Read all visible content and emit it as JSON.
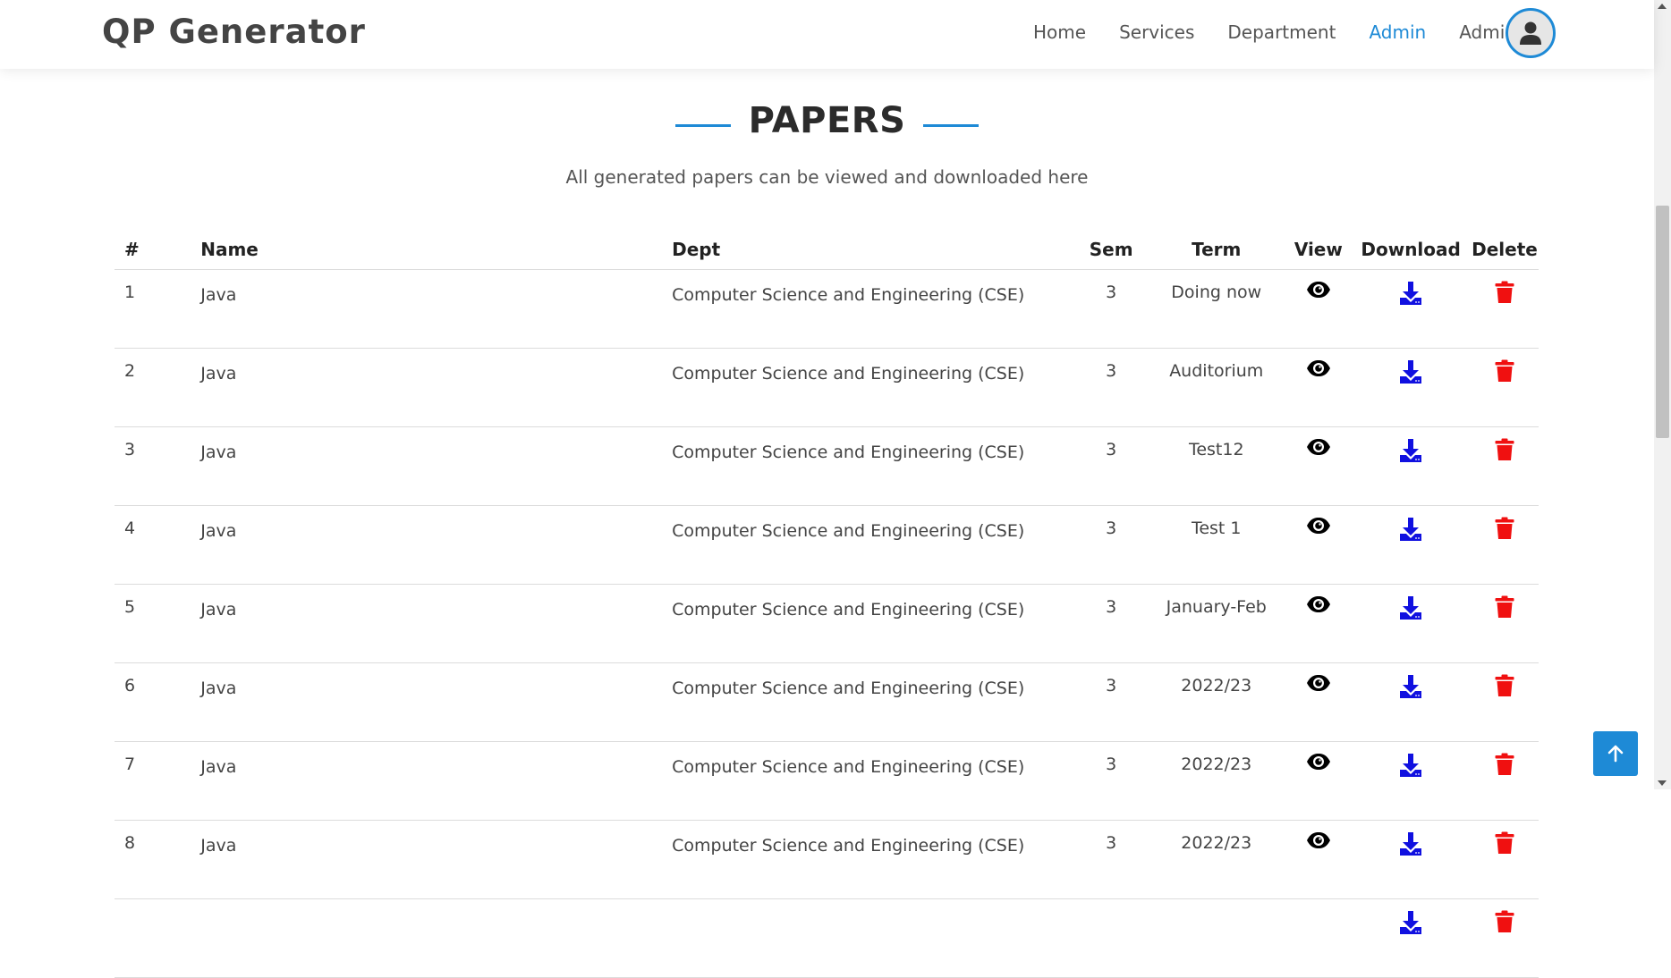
{
  "header": {
    "logo": "QP Generator",
    "nav": [
      {
        "label": "Home",
        "active": false
      },
      {
        "label": "Services",
        "active": false
      },
      {
        "label": "Department",
        "active": false
      },
      {
        "label": "Admin",
        "active": true
      },
      {
        "label": "Admin",
        "active": false
      }
    ],
    "avatar_icon": "user-icon"
  },
  "section": {
    "title": "PAPERS",
    "subtitle": "All generated papers can be viewed and downloaded here"
  },
  "table": {
    "columns": [
      "#",
      "Name",
      "Dept",
      "Sem",
      "Term",
      "View",
      "Download",
      "Delete"
    ],
    "rows": [
      {
        "num": "1",
        "name": "Java",
        "dept": "Computer Science and Engineering (CSE)",
        "sem": "3",
        "term": "Doing now"
      },
      {
        "num": "2",
        "name": "Java",
        "dept": "Computer Science and Engineering (CSE)",
        "sem": "3",
        "term": "Auditorium"
      },
      {
        "num": "3",
        "name": "Java",
        "dept": "Computer Science and Engineering (CSE)",
        "sem": "3",
        "term": "Test12"
      },
      {
        "num": "4",
        "name": "Java",
        "dept": "Computer Science and Engineering (CSE)",
        "sem": "3",
        "term": "Test 1"
      },
      {
        "num": "5",
        "name": "Java",
        "dept": "Computer Science and Engineering (CSE)",
        "sem": "3",
        "term": "January-Feb"
      },
      {
        "num": "6",
        "name": "Java",
        "dept": "Computer Science and Engineering (CSE)",
        "sem": "3",
        "term": "2022/23"
      },
      {
        "num": "7",
        "name": "Java",
        "dept": "Computer Science and Engineering (CSE)",
        "sem": "3",
        "term": "2022/23"
      },
      {
        "num": "8",
        "name": "Java",
        "dept": "Computer Science and Engineering (CSE)",
        "sem": "3",
        "term": "2022/23"
      },
      {
        "num": "",
        "name": "",
        "dept": "",
        "sem": "",
        "term": ""
      }
    ],
    "icons": {
      "view": "eye-icon",
      "download": "download-icon",
      "delete": "trash-icon"
    }
  },
  "colors": {
    "accent": "#1e8ad6",
    "download": "#1010e0",
    "delete": "#f01010",
    "view": "#000000"
  },
  "back_to_top_icon": "arrow-up-icon"
}
